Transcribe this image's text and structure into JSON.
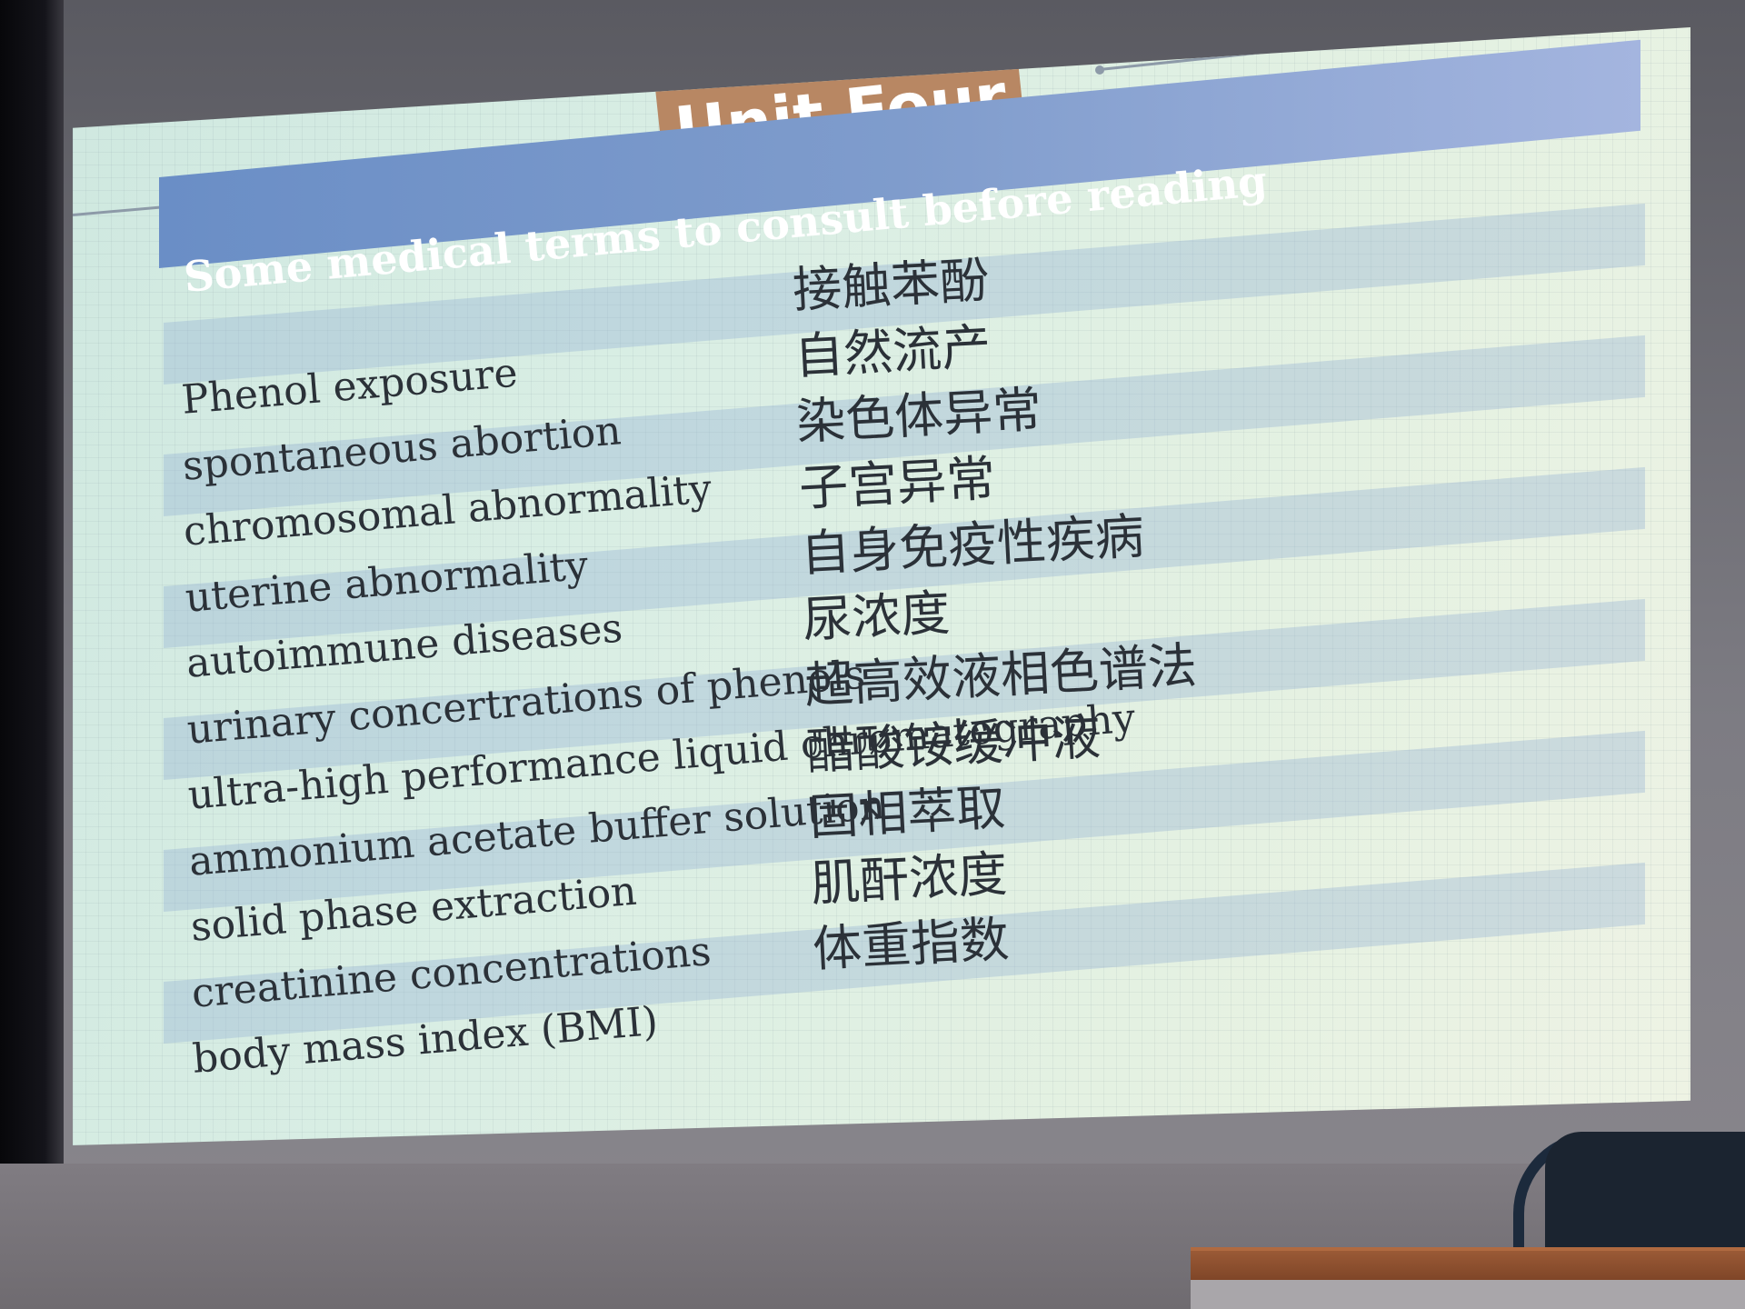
{
  "slide": {
    "unit_title": "Unit Four",
    "header": "Some medical terms to consult before reading",
    "accent_colors": {
      "title_box": "#b88763",
      "header_bar": "#6a8ec6",
      "background": "#d9eee4"
    },
    "terms": [
      {
        "en": "Phenol exposure",
        "zh": "接触苯酚"
      },
      {
        "en": "spontaneous abortion",
        "zh": "自然流产"
      },
      {
        "en": "chromosomal  abnormality",
        "zh": "染色体异常"
      },
      {
        "en": "uterine abnormality",
        "zh": "子宫异常"
      },
      {
        "en": "autoimmune diseases",
        "zh": "自身免疫性疾病"
      },
      {
        "en": "urinary concertrations of phenols",
        "zh": "尿浓度"
      },
      {
        "en": "ultra-high performance liquid chrømatography",
        "zh": "超高效液相色谱法"
      },
      {
        "en": "ammonium acetate buffer solution",
        "zh": "醋酸铵缓冲液"
      },
      {
        "en": "solid phase extraction",
        "zh": "固相萃取"
      },
      {
        "en": "creatinine concentrations",
        "zh": "肌酐浓度"
      },
      {
        "en": "body mass index (BMI)",
        "zh": "体重指数"
      }
    ]
  }
}
